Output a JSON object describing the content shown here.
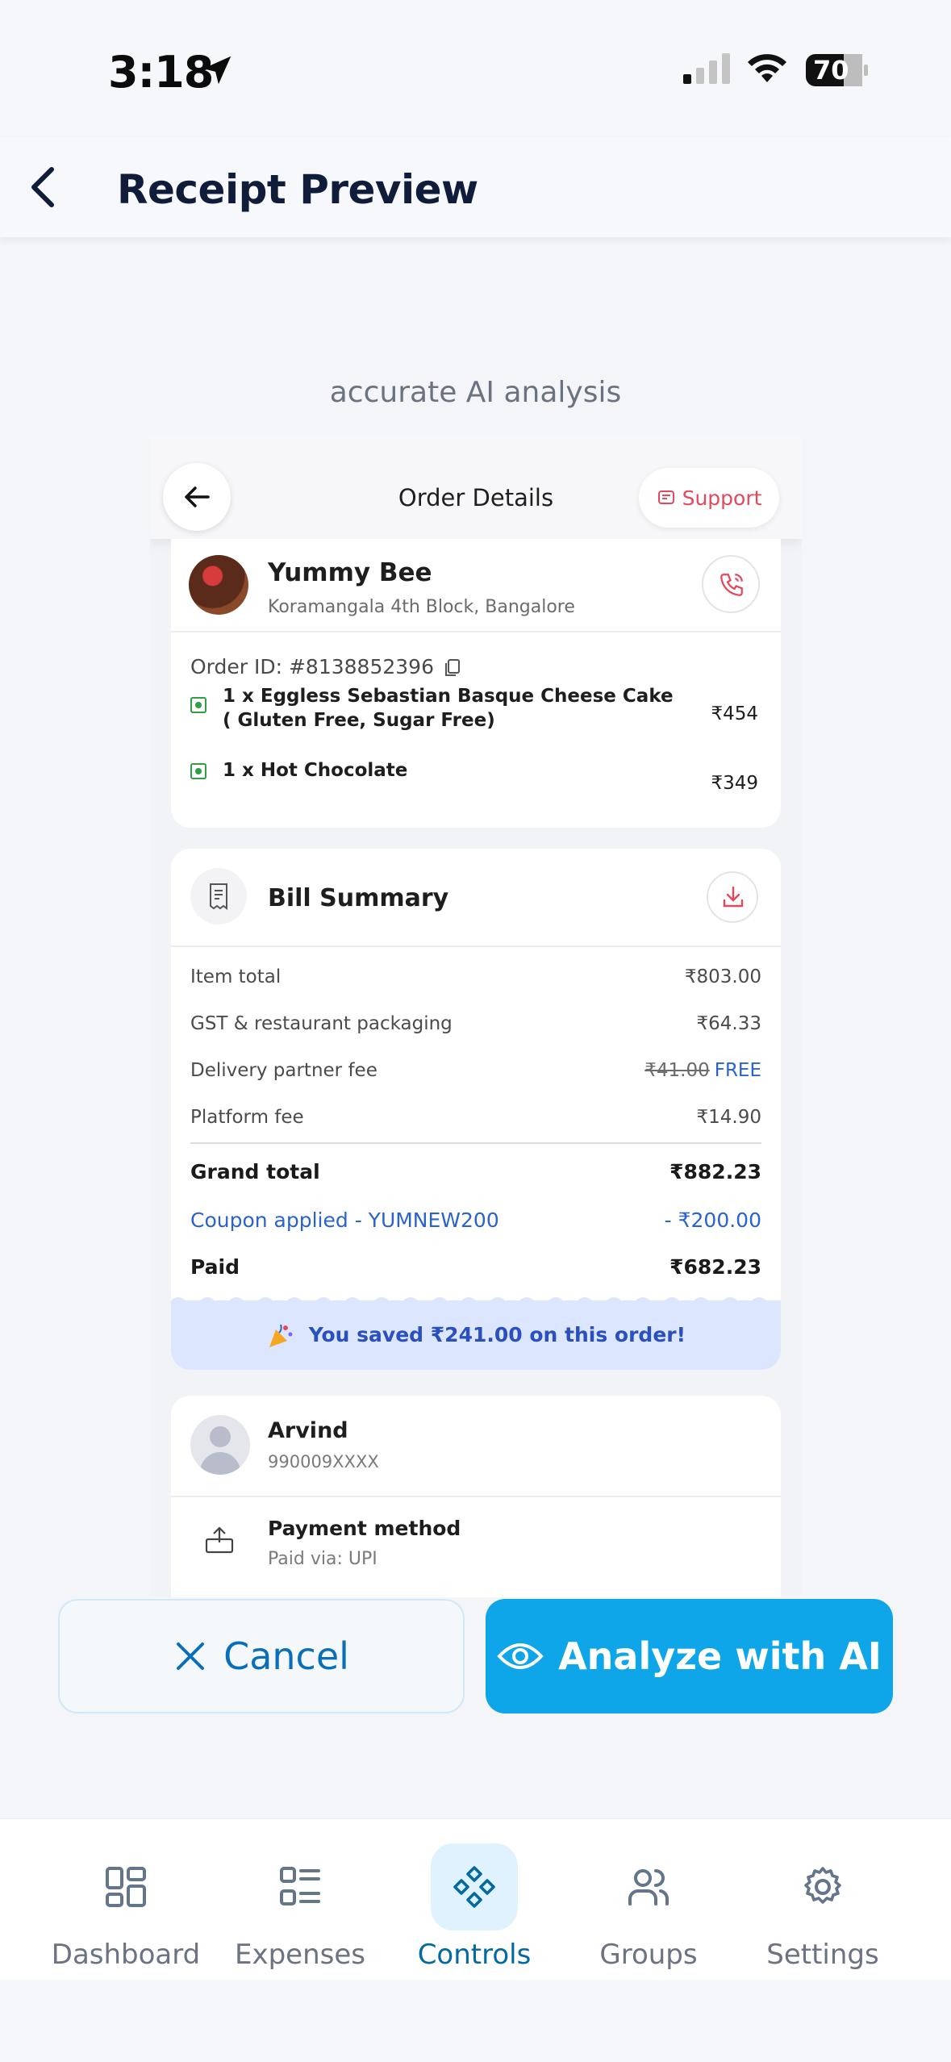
{
  "status_bar": {
    "time": "3:18",
    "battery": "70"
  },
  "header": {
    "title": "Receipt Preview"
  },
  "hint": "accurate AI analysis",
  "receipt": {
    "title": "Order Details",
    "support_label": "Support",
    "restaurant": {
      "name": "Yummy Bee",
      "address": "Koramangala 4th Block, Bangalore"
    },
    "order_id": "Order ID: #8138852396",
    "items": [
      {
        "name_line1": "1 x Eggless Sebastian Basque Cheese Cake",
        "name_line2": "( Gluten Free, Sugar Free)",
        "price": "₹454"
      },
      {
        "name_line1": "1 x Hot Chocolate",
        "name_line2": "",
        "price": "₹349"
      }
    ],
    "bill": {
      "title": "Bill Summary",
      "rows": [
        {
          "label": "Item total",
          "value": "₹803.00"
        },
        {
          "label": "GST & restaurant packaging",
          "value": "₹64.33"
        },
        {
          "label": "Delivery partner fee",
          "value_strike": "₹41.00",
          "value_free": "FREE"
        },
        {
          "label": "Platform fee",
          "value": "₹14.90"
        }
      ],
      "grand_total": {
        "label": "Grand total",
        "value": "₹882.23"
      },
      "coupon": {
        "label": "Coupon applied - YUMNEW200",
        "value": "- ₹200.00"
      },
      "paid": {
        "label": "Paid",
        "value": "₹682.23"
      },
      "saved": "You saved ₹241.00 on this order!"
    },
    "customer": {
      "name": "Arvind",
      "phone": "990009XXXX"
    },
    "payment": {
      "title": "Payment method",
      "subtitle": "Paid via: UPI"
    }
  },
  "actions": {
    "cancel": "Cancel",
    "analyze": "Analyze with AI"
  },
  "tabs": [
    {
      "label": "Dashboard",
      "icon": "grid-icon",
      "active": false
    },
    {
      "label": "Expenses",
      "icon": "list-icon",
      "active": false
    },
    {
      "label": "Controls",
      "icon": "diamond-controls-icon",
      "active": true
    },
    {
      "label": "Groups",
      "icon": "users-icon",
      "active": false
    },
    {
      "label": "Settings",
      "icon": "gear-icon",
      "active": false
    }
  ],
  "colors": {
    "accent": "#0ea5e9",
    "active_tab": "#0369a1",
    "coupon_blue": "#2a63d0",
    "support_red": "#e4485a"
  }
}
